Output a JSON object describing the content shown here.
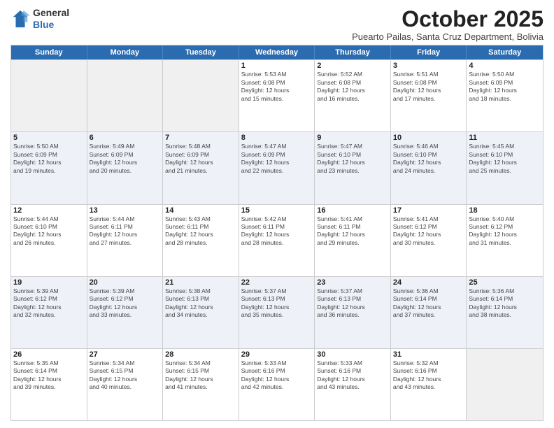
{
  "header": {
    "logo_line1": "General",
    "logo_line2": "Blue",
    "month_title": "October 2025",
    "location": "Puearto Pailas, Santa Cruz Department, Bolivia"
  },
  "day_headers": [
    "Sunday",
    "Monday",
    "Tuesday",
    "Wednesday",
    "Thursday",
    "Friday",
    "Saturday"
  ],
  "weeks": [
    [
      {
        "num": "",
        "info": ""
      },
      {
        "num": "",
        "info": ""
      },
      {
        "num": "",
        "info": ""
      },
      {
        "num": "1",
        "info": "Sunrise: 5:53 AM\nSunset: 6:08 PM\nDaylight: 12 hours\nand 15 minutes."
      },
      {
        "num": "2",
        "info": "Sunrise: 5:52 AM\nSunset: 6:08 PM\nDaylight: 12 hours\nand 16 minutes."
      },
      {
        "num": "3",
        "info": "Sunrise: 5:51 AM\nSunset: 6:08 PM\nDaylight: 12 hours\nand 17 minutes."
      },
      {
        "num": "4",
        "info": "Sunrise: 5:50 AM\nSunset: 6:09 PM\nDaylight: 12 hours\nand 18 minutes."
      }
    ],
    [
      {
        "num": "5",
        "info": "Sunrise: 5:50 AM\nSunset: 6:09 PM\nDaylight: 12 hours\nand 19 minutes."
      },
      {
        "num": "6",
        "info": "Sunrise: 5:49 AM\nSunset: 6:09 PM\nDaylight: 12 hours\nand 20 minutes."
      },
      {
        "num": "7",
        "info": "Sunrise: 5:48 AM\nSunset: 6:09 PM\nDaylight: 12 hours\nand 21 minutes."
      },
      {
        "num": "8",
        "info": "Sunrise: 5:47 AM\nSunset: 6:09 PM\nDaylight: 12 hours\nand 22 minutes."
      },
      {
        "num": "9",
        "info": "Sunrise: 5:47 AM\nSunset: 6:10 PM\nDaylight: 12 hours\nand 23 minutes."
      },
      {
        "num": "10",
        "info": "Sunrise: 5:46 AM\nSunset: 6:10 PM\nDaylight: 12 hours\nand 24 minutes."
      },
      {
        "num": "11",
        "info": "Sunrise: 5:45 AM\nSunset: 6:10 PM\nDaylight: 12 hours\nand 25 minutes."
      }
    ],
    [
      {
        "num": "12",
        "info": "Sunrise: 5:44 AM\nSunset: 6:10 PM\nDaylight: 12 hours\nand 26 minutes."
      },
      {
        "num": "13",
        "info": "Sunrise: 5:44 AM\nSunset: 6:11 PM\nDaylight: 12 hours\nand 27 minutes."
      },
      {
        "num": "14",
        "info": "Sunrise: 5:43 AM\nSunset: 6:11 PM\nDaylight: 12 hours\nand 28 minutes."
      },
      {
        "num": "15",
        "info": "Sunrise: 5:42 AM\nSunset: 6:11 PM\nDaylight: 12 hours\nand 28 minutes."
      },
      {
        "num": "16",
        "info": "Sunrise: 5:41 AM\nSunset: 6:11 PM\nDaylight: 12 hours\nand 29 minutes."
      },
      {
        "num": "17",
        "info": "Sunrise: 5:41 AM\nSunset: 6:12 PM\nDaylight: 12 hours\nand 30 minutes."
      },
      {
        "num": "18",
        "info": "Sunrise: 5:40 AM\nSunset: 6:12 PM\nDaylight: 12 hours\nand 31 minutes."
      }
    ],
    [
      {
        "num": "19",
        "info": "Sunrise: 5:39 AM\nSunset: 6:12 PM\nDaylight: 12 hours\nand 32 minutes."
      },
      {
        "num": "20",
        "info": "Sunrise: 5:39 AM\nSunset: 6:12 PM\nDaylight: 12 hours\nand 33 minutes."
      },
      {
        "num": "21",
        "info": "Sunrise: 5:38 AM\nSunset: 6:13 PM\nDaylight: 12 hours\nand 34 minutes."
      },
      {
        "num": "22",
        "info": "Sunrise: 5:37 AM\nSunset: 6:13 PM\nDaylight: 12 hours\nand 35 minutes."
      },
      {
        "num": "23",
        "info": "Sunrise: 5:37 AM\nSunset: 6:13 PM\nDaylight: 12 hours\nand 36 minutes."
      },
      {
        "num": "24",
        "info": "Sunrise: 5:36 AM\nSunset: 6:14 PM\nDaylight: 12 hours\nand 37 minutes."
      },
      {
        "num": "25",
        "info": "Sunrise: 5:36 AM\nSunset: 6:14 PM\nDaylight: 12 hours\nand 38 minutes."
      }
    ],
    [
      {
        "num": "26",
        "info": "Sunrise: 5:35 AM\nSunset: 6:14 PM\nDaylight: 12 hours\nand 39 minutes."
      },
      {
        "num": "27",
        "info": "Sunrise: 5:34 AM\nSunset: 6:15 PM\nDaylight: 12 hours\nand 40 minutes."
      },
      {
        "num": "28",
        "info": "Sunrise: 5:34 AM\nSunset: 6:15 PM\nDaylight: 12 hours\nand 41 minutes."
      },
      {
        "num": "29",
        "info": "Sunrise: 5:33 AM\nSunset: 6:16 PM\nDaylight: 12 hours\nand 42 minutes."
      },
      {
        "num": "30",
        "info": "Sunrise: 5:33 AM\nSunset: 6:16 PM\nDaylight: 12 hours\nand 43 minutes."
      },
      {
        "num": "31",
        "info": "Sunrise: 5:32 AM\nSunset: 6:16 PM\nDaylight: 12 hours\nand 43 minutes."
      },
      {
        "num": "",
        "info": ""
      }
    ]
  ]
}
